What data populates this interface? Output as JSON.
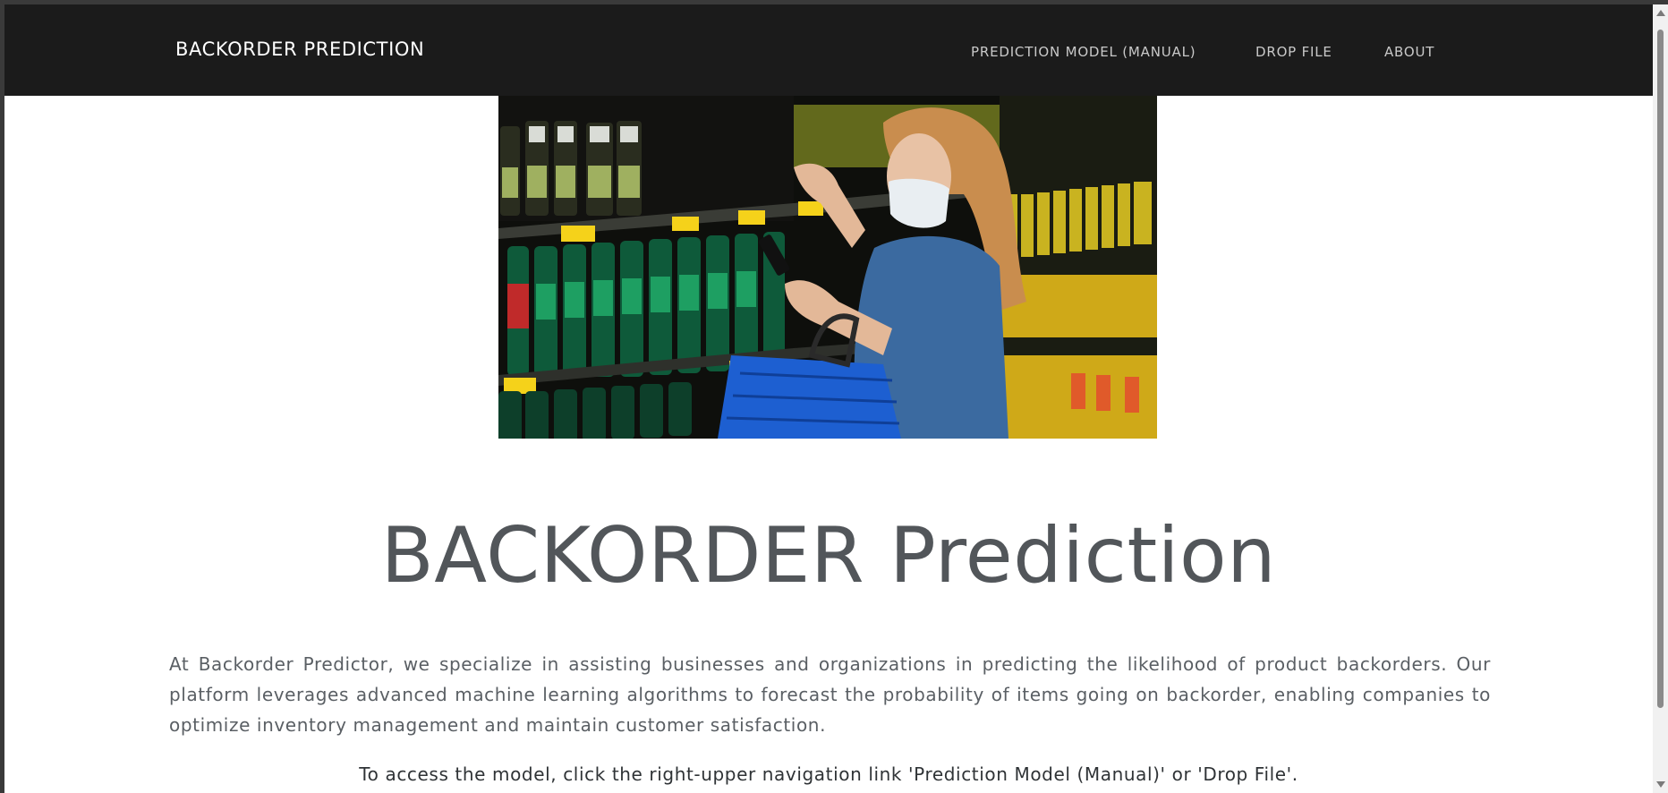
{
  "navbar": {
    "brand": "BACKORDER PREDICTION",
    "links": [
      {
        "label": "PREDICTION MODEL (MANUAL)"
      },
      {
        "label": "DROP FILE"
      },
      {
        "label": "ABOUT"
      }
    ]
  },
  "hero": {
    "image_subject": "woman in face mask shopping at supermarket shelves with basket and phone"
  },
  "main": {
    "title": "BACKORDER Prediction",
    "description": "At Backorder Predictor, we specialize in assisting businesses and organizations in predicting the likelihood of product backorders. Our platform leverages advanced machine learning algorithms to forecast the probability of items going on backorder, enabling companies to optimize inventory management and maintain customer satisfaction.",
    "access_note": "To access the model, click the right-upper navigation link 'Prediction Model (Manual)' or 'Drop File'."
  },
  "colors": {
    "navbar_bg": "#1b1b1b",
    "title_color": "#52565a",
    "text_color": "#5a5f64"
  }
}
